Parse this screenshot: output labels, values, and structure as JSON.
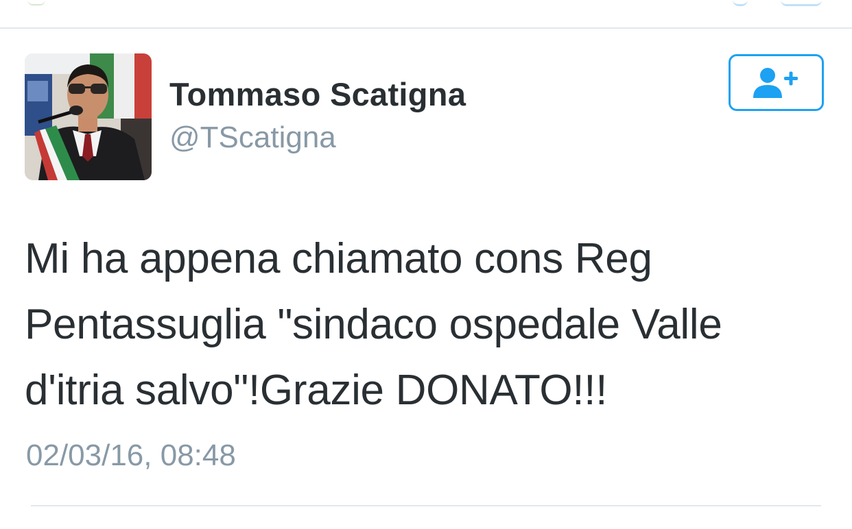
{
  "tweet": {
    "author": {
      "display_name": "Tommaso Scatigna",
      "screen_name": "@TScatigna",
      "avatar_icon": "profile-photo"
    },
    "follow_button": {
      "icon": "add-user-icon",
      "accent_color": "#1da1f2"
    },
    "text_lines": [
      "Mi ha appena chiamato cons Reg",
      "Pentassuglia \"sindaco ospedale Valle",
      "d'itria salvo\"!Grazie DONATO!!!"
    ],
    "timestamp": "02/03/16, 08:48"
  }
}
